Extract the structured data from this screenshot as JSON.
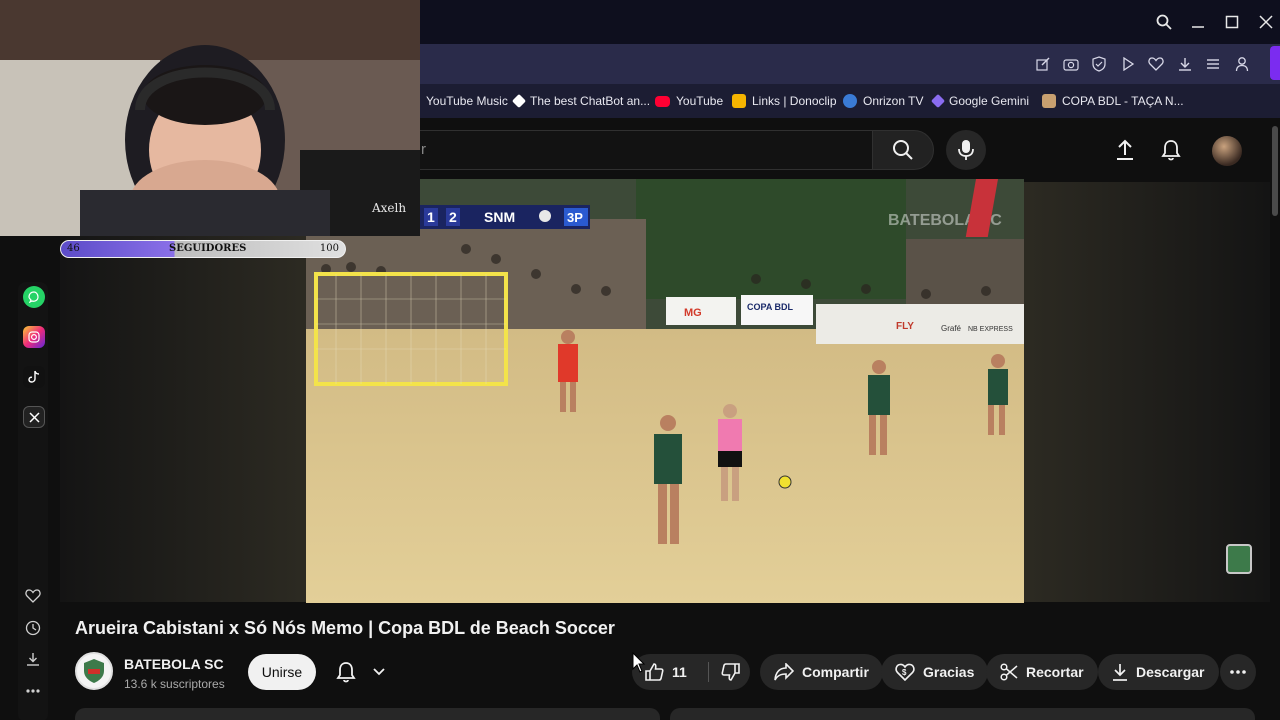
{
  "browser": {
    "window_controls": [
      "search-icon",
      "minimize-icon",
      "maximize-icon",
      "close-icon"
    ],
    "toolbar_icons": [
      "edit-icon",
      "camera-icon",
      "shield-icon",
      "play-icon",
      "heart-icon",
      "download-icon",
      "menu-icon",
      "account-icon"
    ],
    "bookmarks": [
      {
        "label": "YouTube Music",
        "color": "#ff0033"
      },
      {
        "label": "The best ChatBot an...",
        "color": "#ffffff"
      },
      {
        "label": "YouTube",
        "color": "#ff0033"
      },
      {
        "label": "Links | Donoclip",
        "color": "#f5b400"
      },
      {
        "label": "Onrizon TV",
        "color": "#3a7bd5"
      },
      {
        "label": "Google Gemini",
        "color": "#8a6cf0"
      },
      {
        "label": "COPA BDL - TAÇA N...",
        "color": "#c8a070"
      }
    ],
    "accent_color": "#7b2cf0"
  },
  "youtube": {
    "search_placeholder": "r",
    "header_icons": [
      "search-icon",
      "mic-icon",
      "upload-icon",
      "bell-icon",
      "avatar"
    ],
    "scoreboard": {
      "left_digit": "1",
      "right_digit": "2",
      "team": "SNM",
      "period": "3P"
    },
    "video_watermark": "BATEBOLA SC",
    "ads": [
      "MG",
      "COPA BDL",
      "FLY",
      "Grafé",
      "NB EXPRESS"
    ],
    "video": {
      "title": "Arueira Cabistani x Só Nós Memo | Copa BDL de Beach Soccer",
      "channel_name": "BATEBOLA SC",
      "subscribers": "13.6 k suscriptores",
      "join_label": "Unirse",
      "likes": "11",
      "share_label": "Compartir",
      "thanks_label": "Gracias",
      "clip_label": "Recortar",
      "download_label": "Descargar"
    }
  },
  "overlay": {
    "cam_signature": "Axelh",
    "follow_bar": {
      "current": "46",
      "label": "SEGUIDORES",
      "goal": "100",
      "progress": 0.46
    },
    "social_icons": [
      "whatsapp-icon",
      "instagram-icon",
      "tiktok-icon",
      "x-icon"
    ],
    "side_icons": [
      "heart-icon",
      "clock-icon",
      "download-icon",
      "more-icon"
    ]
  }
}
